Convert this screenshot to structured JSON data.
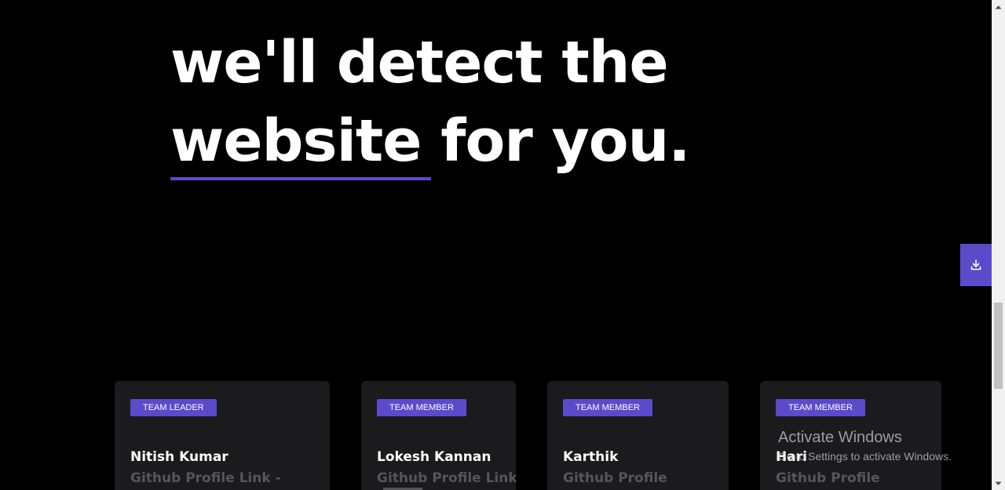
{
  "hero": {
    "line1": "we'll detect the",
    "line2_underlined": "website",
    "line2_rest": " for you."
  },
  "colors": {
    "accent": "#5b4bcb",
    "background": "#000000",
    "card_background": "#1b1b1e",
    "link_text": "#55555c"
  },
  "download_button": {
    "icon": "download-icon"
  },
  "team": [
    {
      "role": "TEAM LEADER",
      "name": "Nitish Kumar",
      "link_text": "Github Profile Link -"
    },
    {
      "role": "TEAM MEMBER",
      "name": "Lokesh Kannan",
      "link_text": "Github Profile Link"
    },
    {
      "role": "TEAM MEMBER",
      "name": "Karthik",
      "link_text": "Github Profile"
    },
    {
      "role": "TEAM MEMBER",
      "name": "Hari",
      "link_text": "Github Profile"
    }
  ],
  "watermark": {
    "title": "Activate Windows",
    "subtitle": "Go to Settings to activate Windows."
  }
}
